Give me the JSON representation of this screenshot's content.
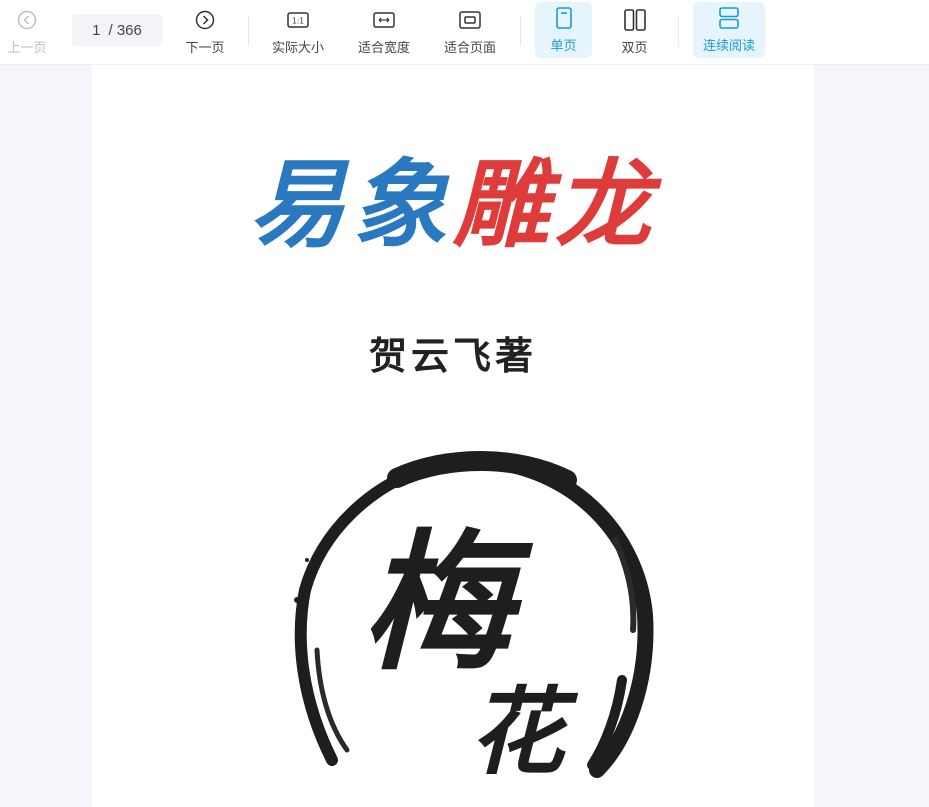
{
  "toolbar": {
    "prev_label": "上一页",
    "page_current": "1",
    "page_total": "/ 366",
    "next_label": "下一页",
    "actual_size_label": "实际大小",
    "actual_size_icon_text": "1:1",
    "fit_width_label": "适合宽度",
    "fit_page_label": "适合页面",
    "single_page_label": "单页",
    "double_page_label": "双页",
    "continuous_label": "连续阅读",
    "accent_color": "#1a9ad6"
  },
  "document": {
    "title_part1": "易象",
    "title_part2": "雕龙",
    "author": "贺云飞著",
    "seal_text_1": "梅",
    "seal_text_2": "花"
  }
}
